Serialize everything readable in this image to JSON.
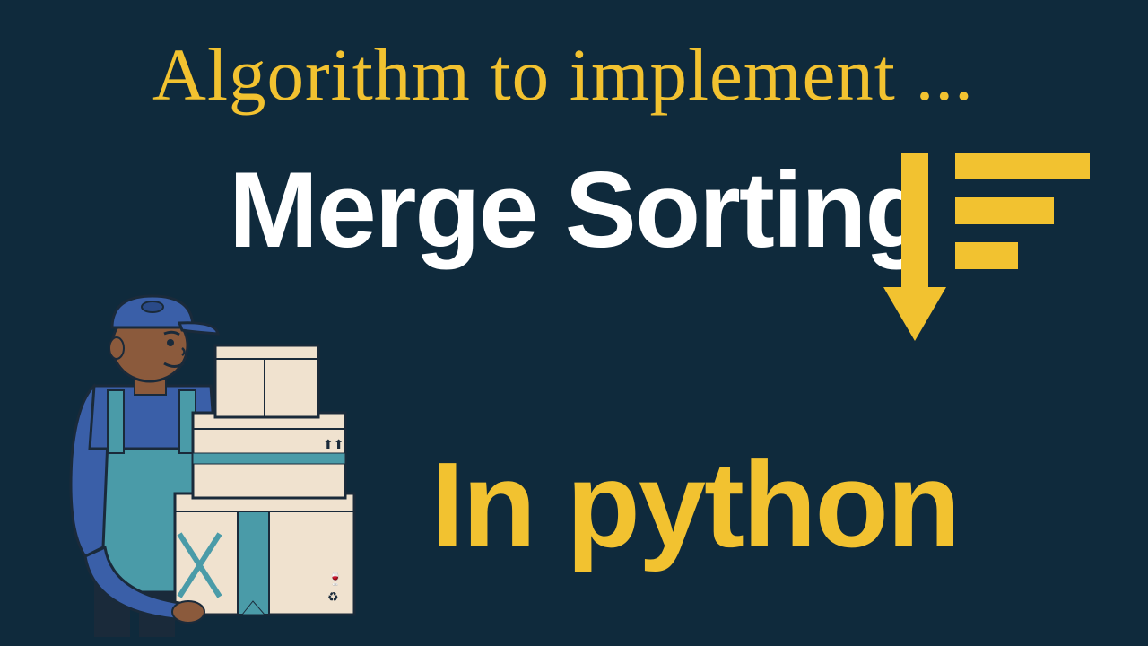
{
  "heading": {
    "script_line": "Algorithm to implement ...",
    "main_title": "Merge Sorting",
    "sub_title": "In python"
  },
  "icons": {
    "sort_icon": "sort-descending-icon",
    "illustration": "delivery-person-with-boxes"
  },
  "colors": {
    "background": "#0f2a3c",
    "accent_yellow": "#f2c230",
    "text_white": "#ffffff",
    "box_beige": "#f0e2cf",
    "person_blue": "#3a5fa8",
    "person_teal": "#4a9ba8",
    "skin": "#8b5a3c"
  }
}
